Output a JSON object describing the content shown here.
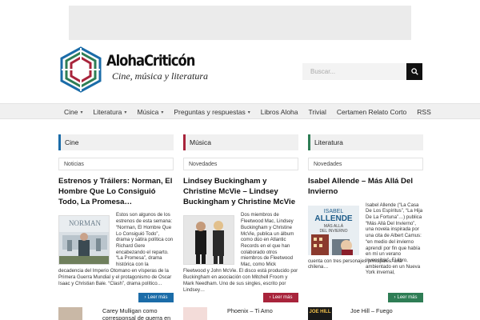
{
  "site": {
    "brand_name": "AlohaCriticón",
    "tagline": "Cine, música y literatura"
  },
  "search": {
    "placeholder": "Buscar..."
  },
  "nav": {
    "items": [
      {
        "label": "Cine",
        "dropdown": true
      },
      {
        "label": "Literatura",
        "dropdown": true
      },
      {
        "label": "Música",
        "dropdown": true
      },
      {
        "label": "Preguntas y respuestas",
        "dropdown": true
      },
      {
        "label": "Libros Aloha",
        "dropdown": false
      },
      {
        "label": "Trivial",
        "dropdown": false
      },
      {
        "label": "Certamen Relato Corto",
        "dropdown": false
      },
      {
        "label": "RSS",
        "dropdown": false
      }
    ]
  },
  "columns": [
    {
      "header": "Cine",
      "subcategory": "Noticias",
      "accent": "#1b6ca8",
      "article_title": "Estrenos y Tráilers: Norman, El Hombre Que Lo Consiguió Todo, La Promesa…",
      "excerpt_side": "Estos son algunos de los estrenos de esta semana: “Norman, El Hombre Que Lo Consiguió Todo”, drama y sátira política con Richard Gere encabezando el reparto. “La Promesa”, drama histórica con la",
      "excerpt_bottom": "decadencia del Imperio Otomano en vísperas de la Primera Guerra Mundial y el protagonismo de Oscar Isaac y Christian Bale. “Clash”, drama político…",
      "read_more": "Leer más",
      "next_title": "Carey Mulligan como corresponsal de guerra en"
    },
    {
      "header": "Música",
      "subcategory": "Novedades",
      "accent": "#a8243b",
      "article_title": "Lindsey Buckingham y Christine McVie – Lindsey Buckingham y Christine McVie",
      "excerpt_side": "Dos miembros de Fleetwood Mac, Lindsey Buckingham y Christine McVie, publica un álbum como dúo en Atlantic Records en el que han colaborado otros miembros de Fleetwood Mac, como Mick",
      "excerpt_bottom": "Fleetwood y John McVie. El disco está producido por Buckingham en asociación con Mitchell Froom y Mark Needham. Uno de sus singles, escrito por Lindsey…",
      "read_more": "Leer más",
      "next_title": "Phoenix – Ti Amo"
    },
    {
      "header": "Literatura",
      "subcategory": "Novedades",
      "accent": "#2e7d55",
      "article_title": "Isabel Allende – Más Allá Del Invierno",
      "excerpt_side": "Isabel Allende (“La Casa De Los Espíritus”, “La Hija De La Fortuna”…) publica “Más Allá Del Invierno”, una novela inspirada por una cita de Albert Camus: “en medio del invierno aprendí por fin que había en mí un verano invencible”. El libro, ambientado en un Nueva York invernal,",
      "excerpt_bottom": "cuenta con tres personajes principales: una chilena…",
      "read_more": "Leer más",
      "next_title": "Joe Hill – Fuego"
    }
  ],
  "book_cover": {
    "author_first": "ISABEL",
    "author_last": "ALLENDE",
    "title_line1": "MÁS ALLÁ",
    "title_line2": "DEL INVIERNO"
  },
  "movie_poster": {
    "title": "NORMAN"
  },
  "joe_hill_cover": {
    "text": "JOE HILL"
  }
}
